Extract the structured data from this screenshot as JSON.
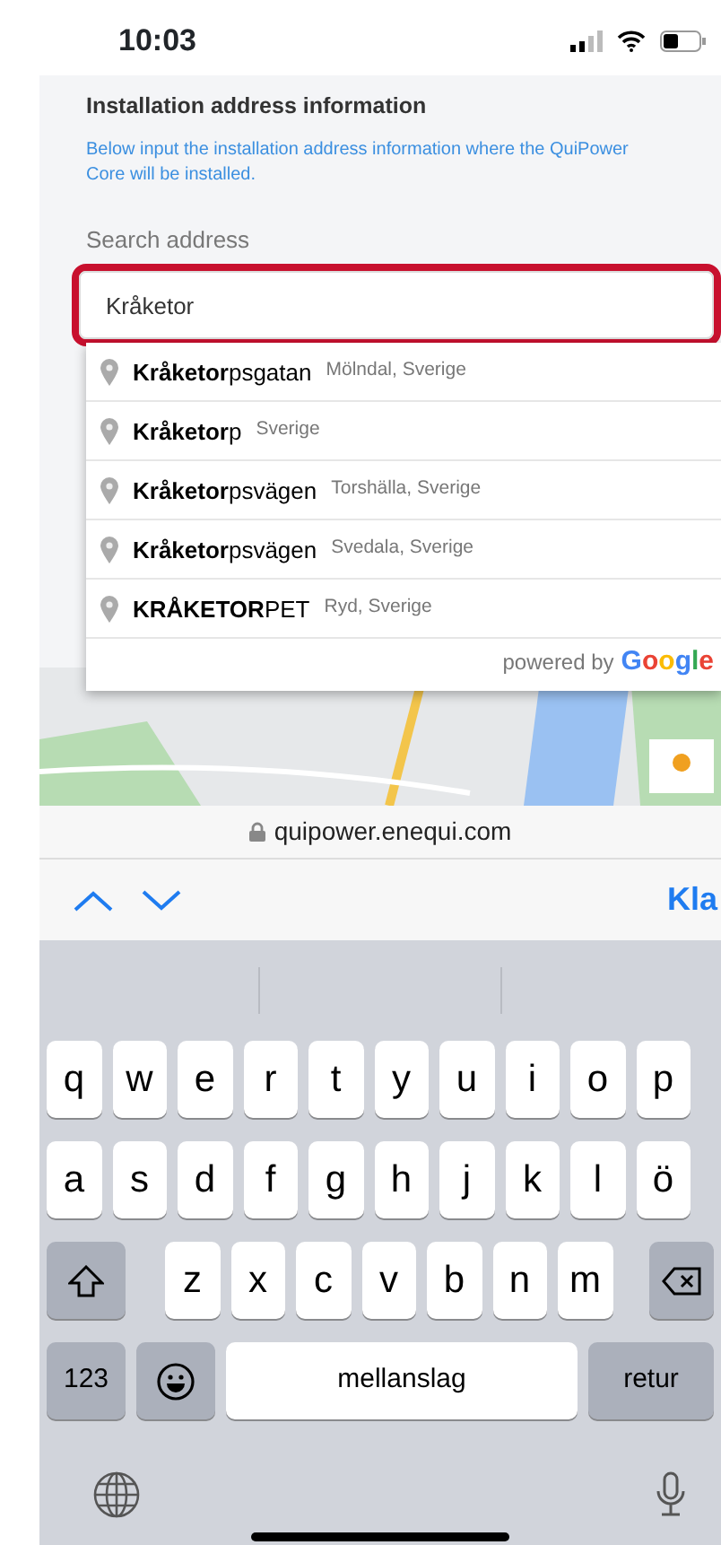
{
  "status_bar": {
    "time": "10:03"
  },
  "form": {
    "title": "Installation address information",
    "description": "Below input the installation address information where the QuiPower Core will be installed.",
    "search_label": "Search address",
    "search_value": "Kråketor",
    "highlighted": true
  },
  "suggestions": [
    {
      "main": "**Kråketor**psgatan",
      "secondary": "Mölndal, Sverige"
    },
    {
      "main": "**Kråketor**p",
      "secondary": "Sverige"
    },
    {
      "main": "**Kråketor**psvägen",
      "secondary": "Torshälla, Sverige"
    },
    {
      "main": "**Kråketor**psvägen",
      "secondary": "Svedala, Sverige"
    },
    {
      "main": "**KRÅKETOR**PET",
      "secondary": "Ryd, Sverige"
    }
  ],
  "attribution": {
    "text": "powered by",
    "brand": "Google"
  },
  "url_bar": {
    "url": "quipower.enequi.com"
  },
  "toolbar": {
    "done": "Kla"
  },
  "keyboard": {
    "top_row": [
      "q",
      "w",
      "e",
      "r",
      "t",
      "y",
      "u",
      "i",
      "o",
      "p"
    ],
    "middle_row": [
      "a",
      "s",
      "d",
      "f",
      "g",
      "h",
      "j",
      "k",
      "l",
      "ö"
    ],
    "lower_row": {
      "letters": [
        "z",
        "x",
        "c",
        "v",
        "b",
        "n",
        "m"
      ]
    },
    "function_row": {
      "numbers": "123",
      "space": "mellanslag",
      "return": "retur"
    }
  }
}
